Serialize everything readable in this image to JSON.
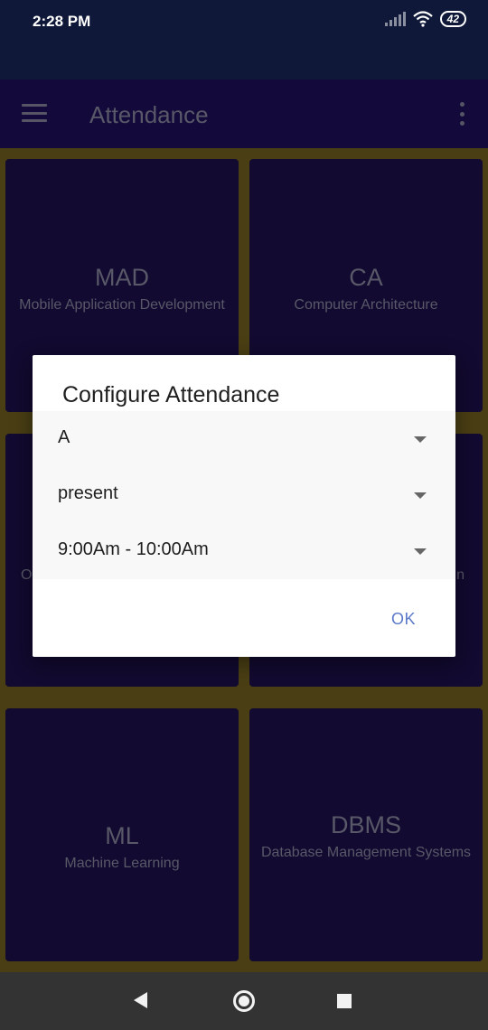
{
  "status_bar": {
    "time": "2:28 PM",
    "battery": "42"
  },
  "app_bar": {
    "title": "Attendance"
  },
  "subjects": [
    {
      "code": "MAD",
      "name": "Mobile Application Development"
    },
    {
      "code": "CA",
      "name": "Computer Architecture"
    },
    {
      "code": "O",
      "name": ""
    },
    {
      "code": "",
      "name": "n"
    },
    {
      "code": "ML",
      "name": "Machine Learning"
    },
    {
      "code": "DBMS",
      "name": "Database Management Systems"
    }
  ],
  "dialog": {
    "title": "Configure Attendance",
    "division": "A",
    "status": "present",
    "time_slot": "9:00Am - 10:00Am",
    "ok_label": "OK"
  }
}
